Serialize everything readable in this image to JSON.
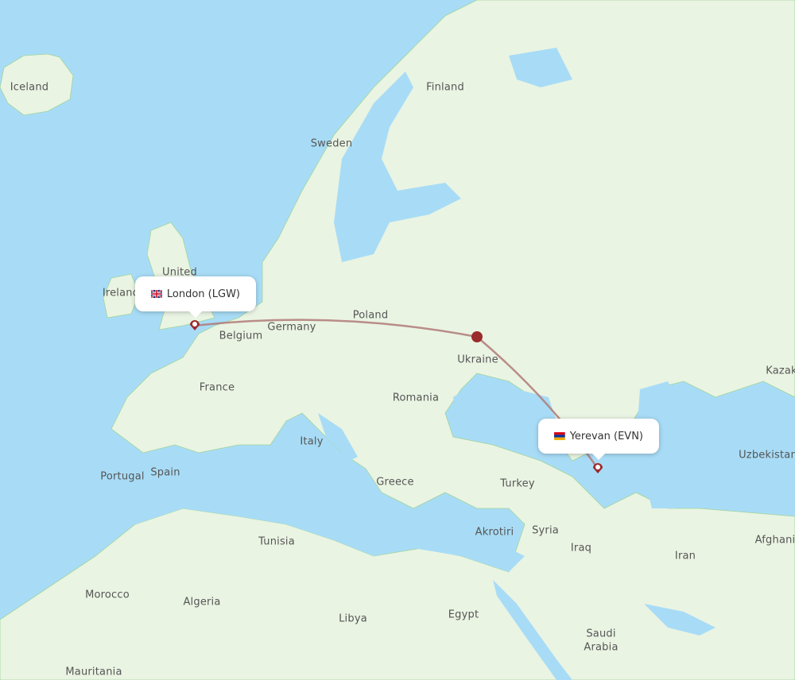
{
  "map": {
    "colors": {
      "water": "#a8dcf6",
      "land": "#eaf4e3",
      "border": "#9fd49a",
      "route": "#b07a78",
      "marker": "#9b2c2c"
    },
    "country_labels": [
      {
        "name": "Iceland"
      },
      {
        "name": "Finland"
      },
      {
        "name": "Sweden"
      },
      {
        "name": "United"
      },
      {
        "name": "Ireland"
      },
      {
        "name": "Poland"
      },
      {
        "name": "Germany"
      },
      {
        "name": "Belgium"
      },
      {
        "name": "France"
      },
      {
        "name": "Ukraine"
      },
      {
        "name": "Romania"
      },
      {
        "name": "Italy"
      },
      {
        "name": "Portugal"
      },
      {
        "name": "Spain"
      },
      {
        "name": "Greece"
      },
      {
        "name": "Turkey"
      },
      {
        "name": "Akrotiri"
      },
      {
        "name": "Syria"
      },
      {
        "name": "Iraq"
      },
      {
        "name": "Iran"
      },
      {
        "name": "Tunisia"
      },
      {
        "name": "Morocco"
      },
      {
        "name": "Algeria"
      },
      {
        "name": "Libya"
      },
      {
        "name": "Egypt"
      },
      {
        "name": "Saudi"
      },
      {
        "name": "Arabia"
      },
      {
        "name": "Mauritania"
      },
      {
        "name": "Kazak"
      },
      {
        "name": "Uzbekistan"
      },
      {
        "name": "Afghani"
      }
    ],
    "origin": {
      "city": "London",
      "code": "LGW",
      "label": "London (LGW)",
      "flag": "united-kingdom-flag"
    },
    "destination": {
      "city": "Yerevan",
      "code": "EVN",
      "label": "Yerevan (EVN)",
      "flag": "armenia-flag"
    }
  }
}
